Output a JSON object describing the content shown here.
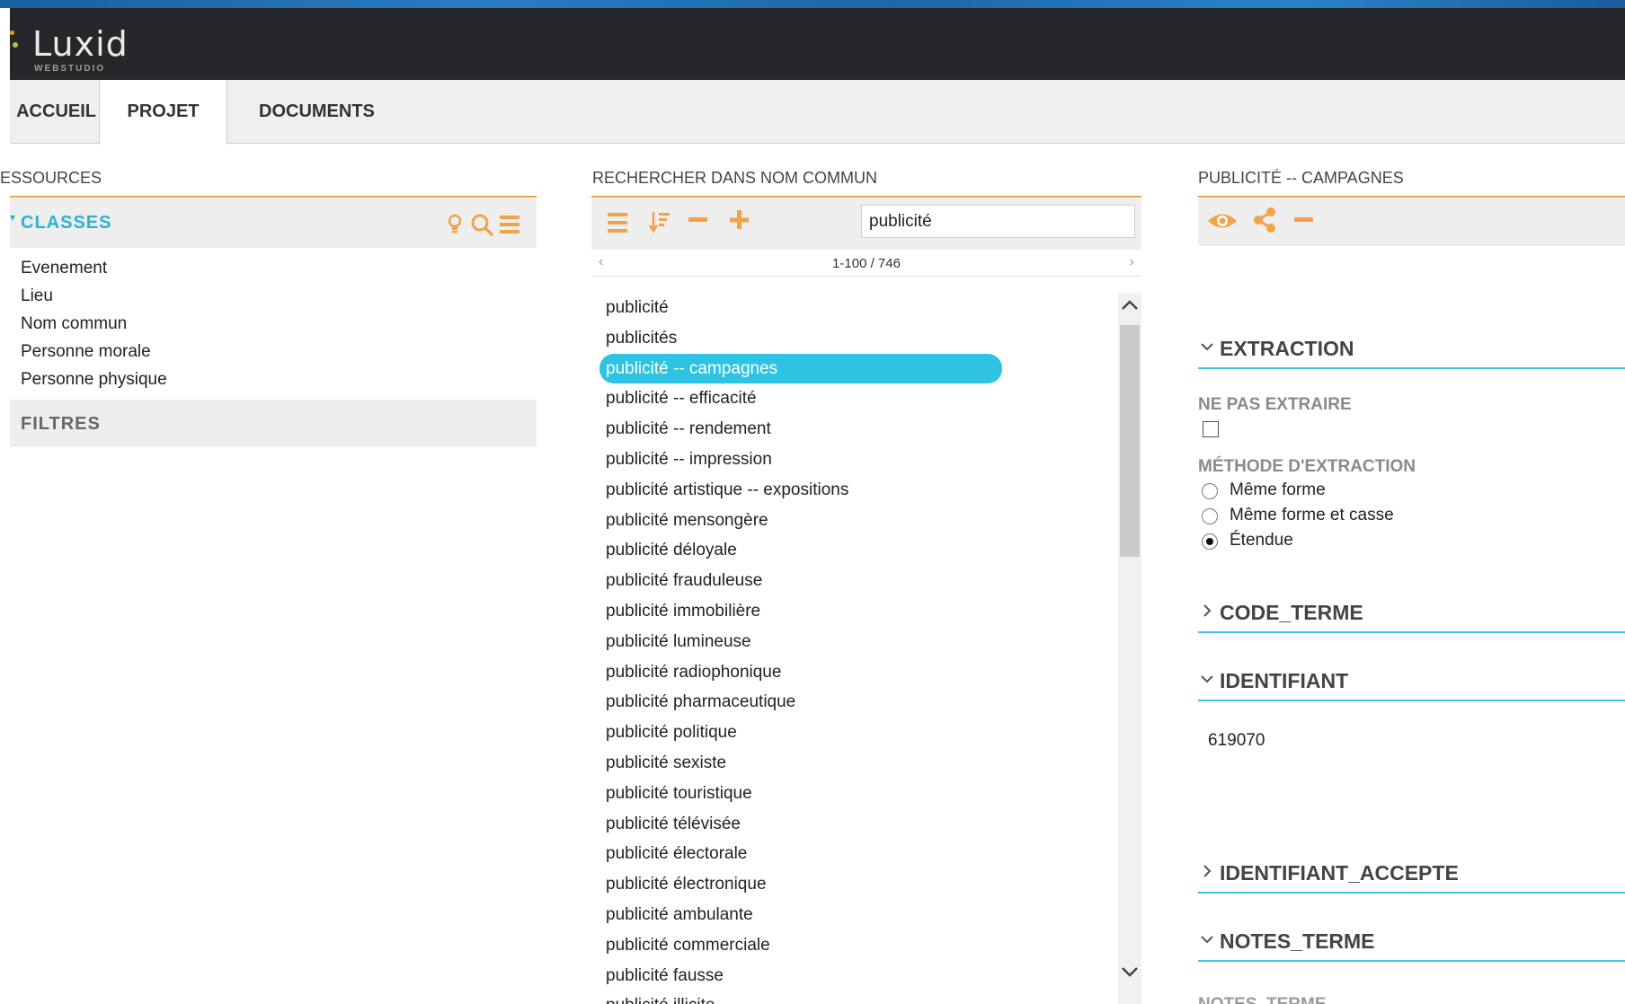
{
  "app": {
    "logo_text": "Luxid",
    "logo_sub": "WEBSTUDIO"
  },
  "tabs": [
    {
      "label": "ACCUEIL",
      "active": false
    },
    {
      "label": "PROJET",
      "active": true
    },
    {
      "label": "DOCUMENTS",
      "active": false
    }
  ],
  "left": {
    "title": "RESSOURCES",
    "classes_title": "CLASSES",
    "classes": [
      "Evenement",
      "Lieu",
      "Nom commun",
      "Personne morale",
      "Personne physique"
    ],
    "filters_title": "FILTRES",
    "icons": [
      "lightbulb-icon",
      "search-icon",
      "menu-icon"
    ]
  },
  "middle": {
    "title": "RECHERCHER DANS NOM COMMUN",
    "search_value": "publicité",
    "pager": "1-100 / 746",
    "selected_index": 2,
    "results": [
      "publicité",
      "publicités",
      "publicité -- campagnes",
      "publicité -- efficacité",
      "publicité -- rendement",
      "publicité -- impression",
      "publicité artistique -- expositions",
      "publicité mensongère",
      "publicité déloyale",
      "publicité frauduleuse",
      "publicité immobilière",
      "publicité lumineuse",
      "publicité radiophonique",
      "publicité pharmaceutique",
      "publicité politique",
      "publicité sexiste",
      "publicité touristique",
      "publicité télévisée",
      "publicité électorale",
      "publicité électronique",
      "publicité ambulante",
      "publicité commerciale",
      "publicité fausse",
      "publicité illicite"
    ],
    "icons": [
      "list-icon",
      "sort-icon",
      "minus-icon",
      "plus-icon"
    ]
  },
  "right": {
    "title": "PUBLICITÉ -- CAMPAGNES",
    "icons": [
      "eye-icon",
      "share-icon",
      "minus-icon"
    ],
    "extraction": {
      "title": "EXTRACTION",
      "no_extract_label": "NE PAS EXTRAIRE",
      "no_extract_checked": false,
      "method_label": "MÉTHODE D'EXTRACTION",
      "methods": [
        "Même forme",
        "Même forme et casse",
        "Étendue"
      ],
      "selected_method": "Étendue"
    },
    "code_terme": {
      "title": "CODE_TERME",
      "expanded": false
    },
    "identifiant": {
      "title": "IDENTIFIANT",
      "value": "619070",
      "expanded": true
    },
    "identifiant_accepte": {
      "title": "IDENTIFIANT_ACCEPTE",
      "expanded": false
    },
    "notes_terme": {
      "title": "NOTES_TERME",
      "expanded": true,
      "field_label": "NOTES_TERME"
    }
  },
  "colors": {
    "accent_orange": "#f0a34a",
    "accent_cyan": "#2ab3d6",
    "selection": "#2fc3e3",
    "header_bg": "#25272a"
  }
}
